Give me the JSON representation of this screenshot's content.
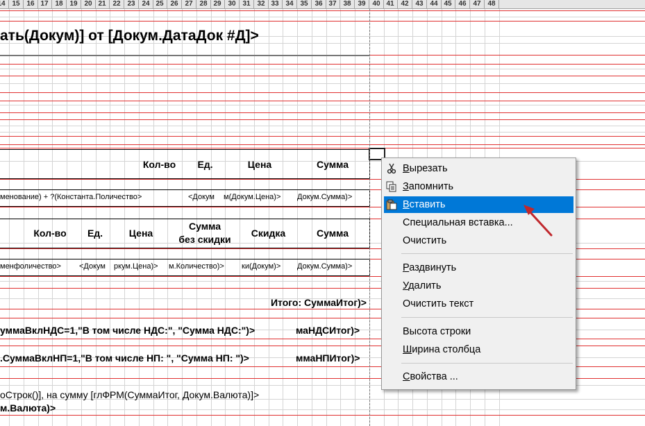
{
  "column_headers": [
    "14",
    "15",
    "16",
    "17",
    "18",
    "19",
    "20",
    "21",
    "22",
    "23",
    "24",
    "25",
    "26",
    "27",
    "28",
    "29",
    "30",
    "31",
    "32",
    "33",
    "34",
    "35",
    "36",
    "37",
    "38",
    "39",
    "40",
    "41",
    "42",
    "43",
    "44",
    "45",
    "46",
    "47",
    "48"
  ],
  "title_text": "ать(Докум)] от [Докум.ДатаДок #Д]>",
  "table1": {
    "headers": [
      "Кол-во",
      "Ед.",
      "Цена",
      "Сумма"
    ],
    "formula_row": [
      "менование) + ?(Константа.Поличество>",
      "<Докум",
      "м(Докум.Цена)>",
      "Докум.Сумма)>"
    ]
  },
  "table2": {
    "headers": [
      "Кол-во",
      "Ед.",
      "Цена",
      "Сумма без скидки",
      "Скидка",
      "Сумма"
    ],
    "headers_line2": "без скидки",
    "headers_line1": "Сумма",
    "formula_row": [
      "менфоличество>",
      "<Докум",
      "ркум.Цена)>",
      "м.Количество)>",
      "ки(Докум)>",
      "Докум.Сумма)>"
    ]
  },
  "totals": {
    "itogo": "Итого: СуммаИтог)>",
    "nds": "уммаВклНДС=1,\"В том числе НДС:\", \"Сумма НДС:\")>",
    "nds_tail": "маНДСИтог)>",
    "np": ".СуммаВклНП=1,\"В том числе НП:  \", \"Сумма НП:  \")>",
    "np_tail": "ммаНПИтог)>",
    "summary": "оСтрок()], на сумму [глФРМ(СуммаИтог, Докум.Валюта)]>",
    "currency": "м.Валюта)>"
  },
  "context_menu": {
    "items": [
      {
        "label": "Вырезать",
        "icon": "cut-icon",
        "accel": "В"
      },
      {
        "label": "Запомнить",
        "icon": "copy-icon",
        "accel": "З"
      },
      {
        "label": "Вставить",
        "icon": "paste-icon",
        "accel": "В",
        "selected": true
      },
      {
        "label": "Специальная вставка...",
        "icon": "",
        "accel": ""
      },
      {
        "label": "Очистить",
        "icon": "",
        "accel": ""
      },
      {
        "label": "Раздвинуть",
        "icon": "",
        "accel": "Р"
      },
      {
        "label": "Удалить",
        "icon": "",
        "accel": "У"
      },
      {
        "label": "Очистить текст",
        "icon": "",
        "accel": ""
      },
      {
        "label": "Высота строки",
        "icon": "",
        "accel": ""
      },
      {
        "label": "Ширина столбца",
        "icon": "",
        "accel": "Ш"
      },
      {
        "label": "Свойства ...",
        "icon": "",
        "accel": "С"
      }
    ]
  },
  "colors": {
    "grid_red": "#e03030",
    "grid_gray": "#d4d4d4",
    "menu_selection": "#0078d7",
    "pointer_arrow": "#c0282d"
  }
}
